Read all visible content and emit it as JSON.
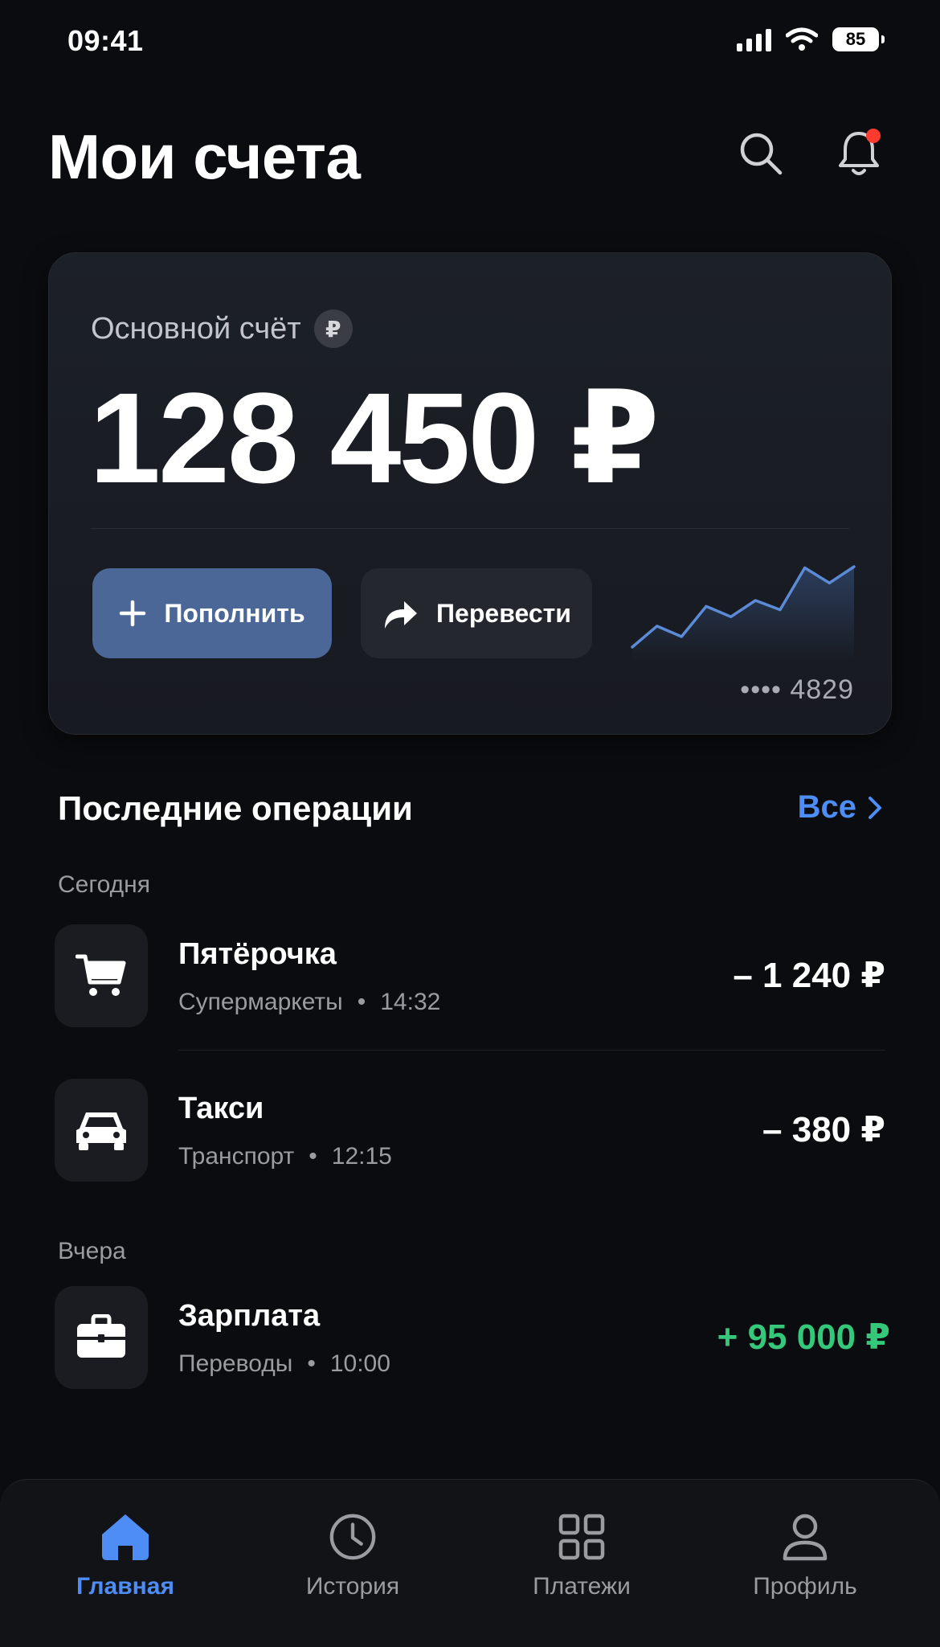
{
  "status_bar": {
    "time": "09:41",
    "battery": "85"
  },
  "header": {
    "title": "Мои счета"
  },
  "account": {
    "label": "Основной счёт",
    "currency_symbol": "₽",
    "balance": "128 450 ₽",
    "topup_label": "Пополнить",
    "transfer_label": "Перевести",
    "card_masked": "•••• 4829"
  },
  "sparkline": [
    {
      "x": 0,
      "y": 1.0
    },
    {
      "x": 1,
      "y": 2.8
    },
    {
      "x": 2,
      "y": 1.9
    },
    {
      "x": 3,
      "y": 4.5
    },
    {
      "x": 4,
      "y": 3.6
    },
    {
      "x": 5,
      "y": 5.0
    },
    {
      "x": 6,
      "y": 4.2
    },
    {
      "x": 7,
      "y": 7.8
    },
    {
      "x": 8,
      "y": 6.5
    },
    {
      "x": 9,
      "y": 7.9
    }
  ],
  "recent": {
    "title": "Последние операции",
    "see_all": "Все",
    "days": [
      {
        "label": "Сегодня",
        "items": [
          {
            "name": "Пятёрочка",
            "category": "Супермаркеты",
            "time": "14:32",
            "amount": "– 1 240 ₽",
            "icon": "cart-icon",
            "type": "expense"
          },
          {
            "name": "Такси",
            "category": "Транспорт",
            "time": "12:15",
            "amount": "– 380 ₽",
            "icon": "car-icon",
            "type": "expense"
          }
        ]
      },
      {
        "label": "Вчера",
        "items": [
          {
            "name": "Зарплата",
            "category": "Переводы",
            "time": "10:00",
            "amount": "+ 95 000 ₽",
            "icon": "briefcase-icon",
            "type": "income"
          }
        ]
      }
    ]
  },
  "nav": {
    "items": [
      {
        "label": "Главная",
        "icon": "home-icon",
        "active": true
      },
      {
        "label": "История",
        "icon": "clock-icon",
        "active": false
      },
      {
        "label": "Платежи",
        "icon": "grid-icon",
        "active": false
      },
      {
        "label": "Профиль",
        "icon": "user-icon",
        "active": false
      }
    ]
  },
  "colors": {
    "accent": "#4e8df5",
    "income": "#35c77a",
    "notification": "#ff3b30",
    "topup_button": "#4a6798"
  }
}
